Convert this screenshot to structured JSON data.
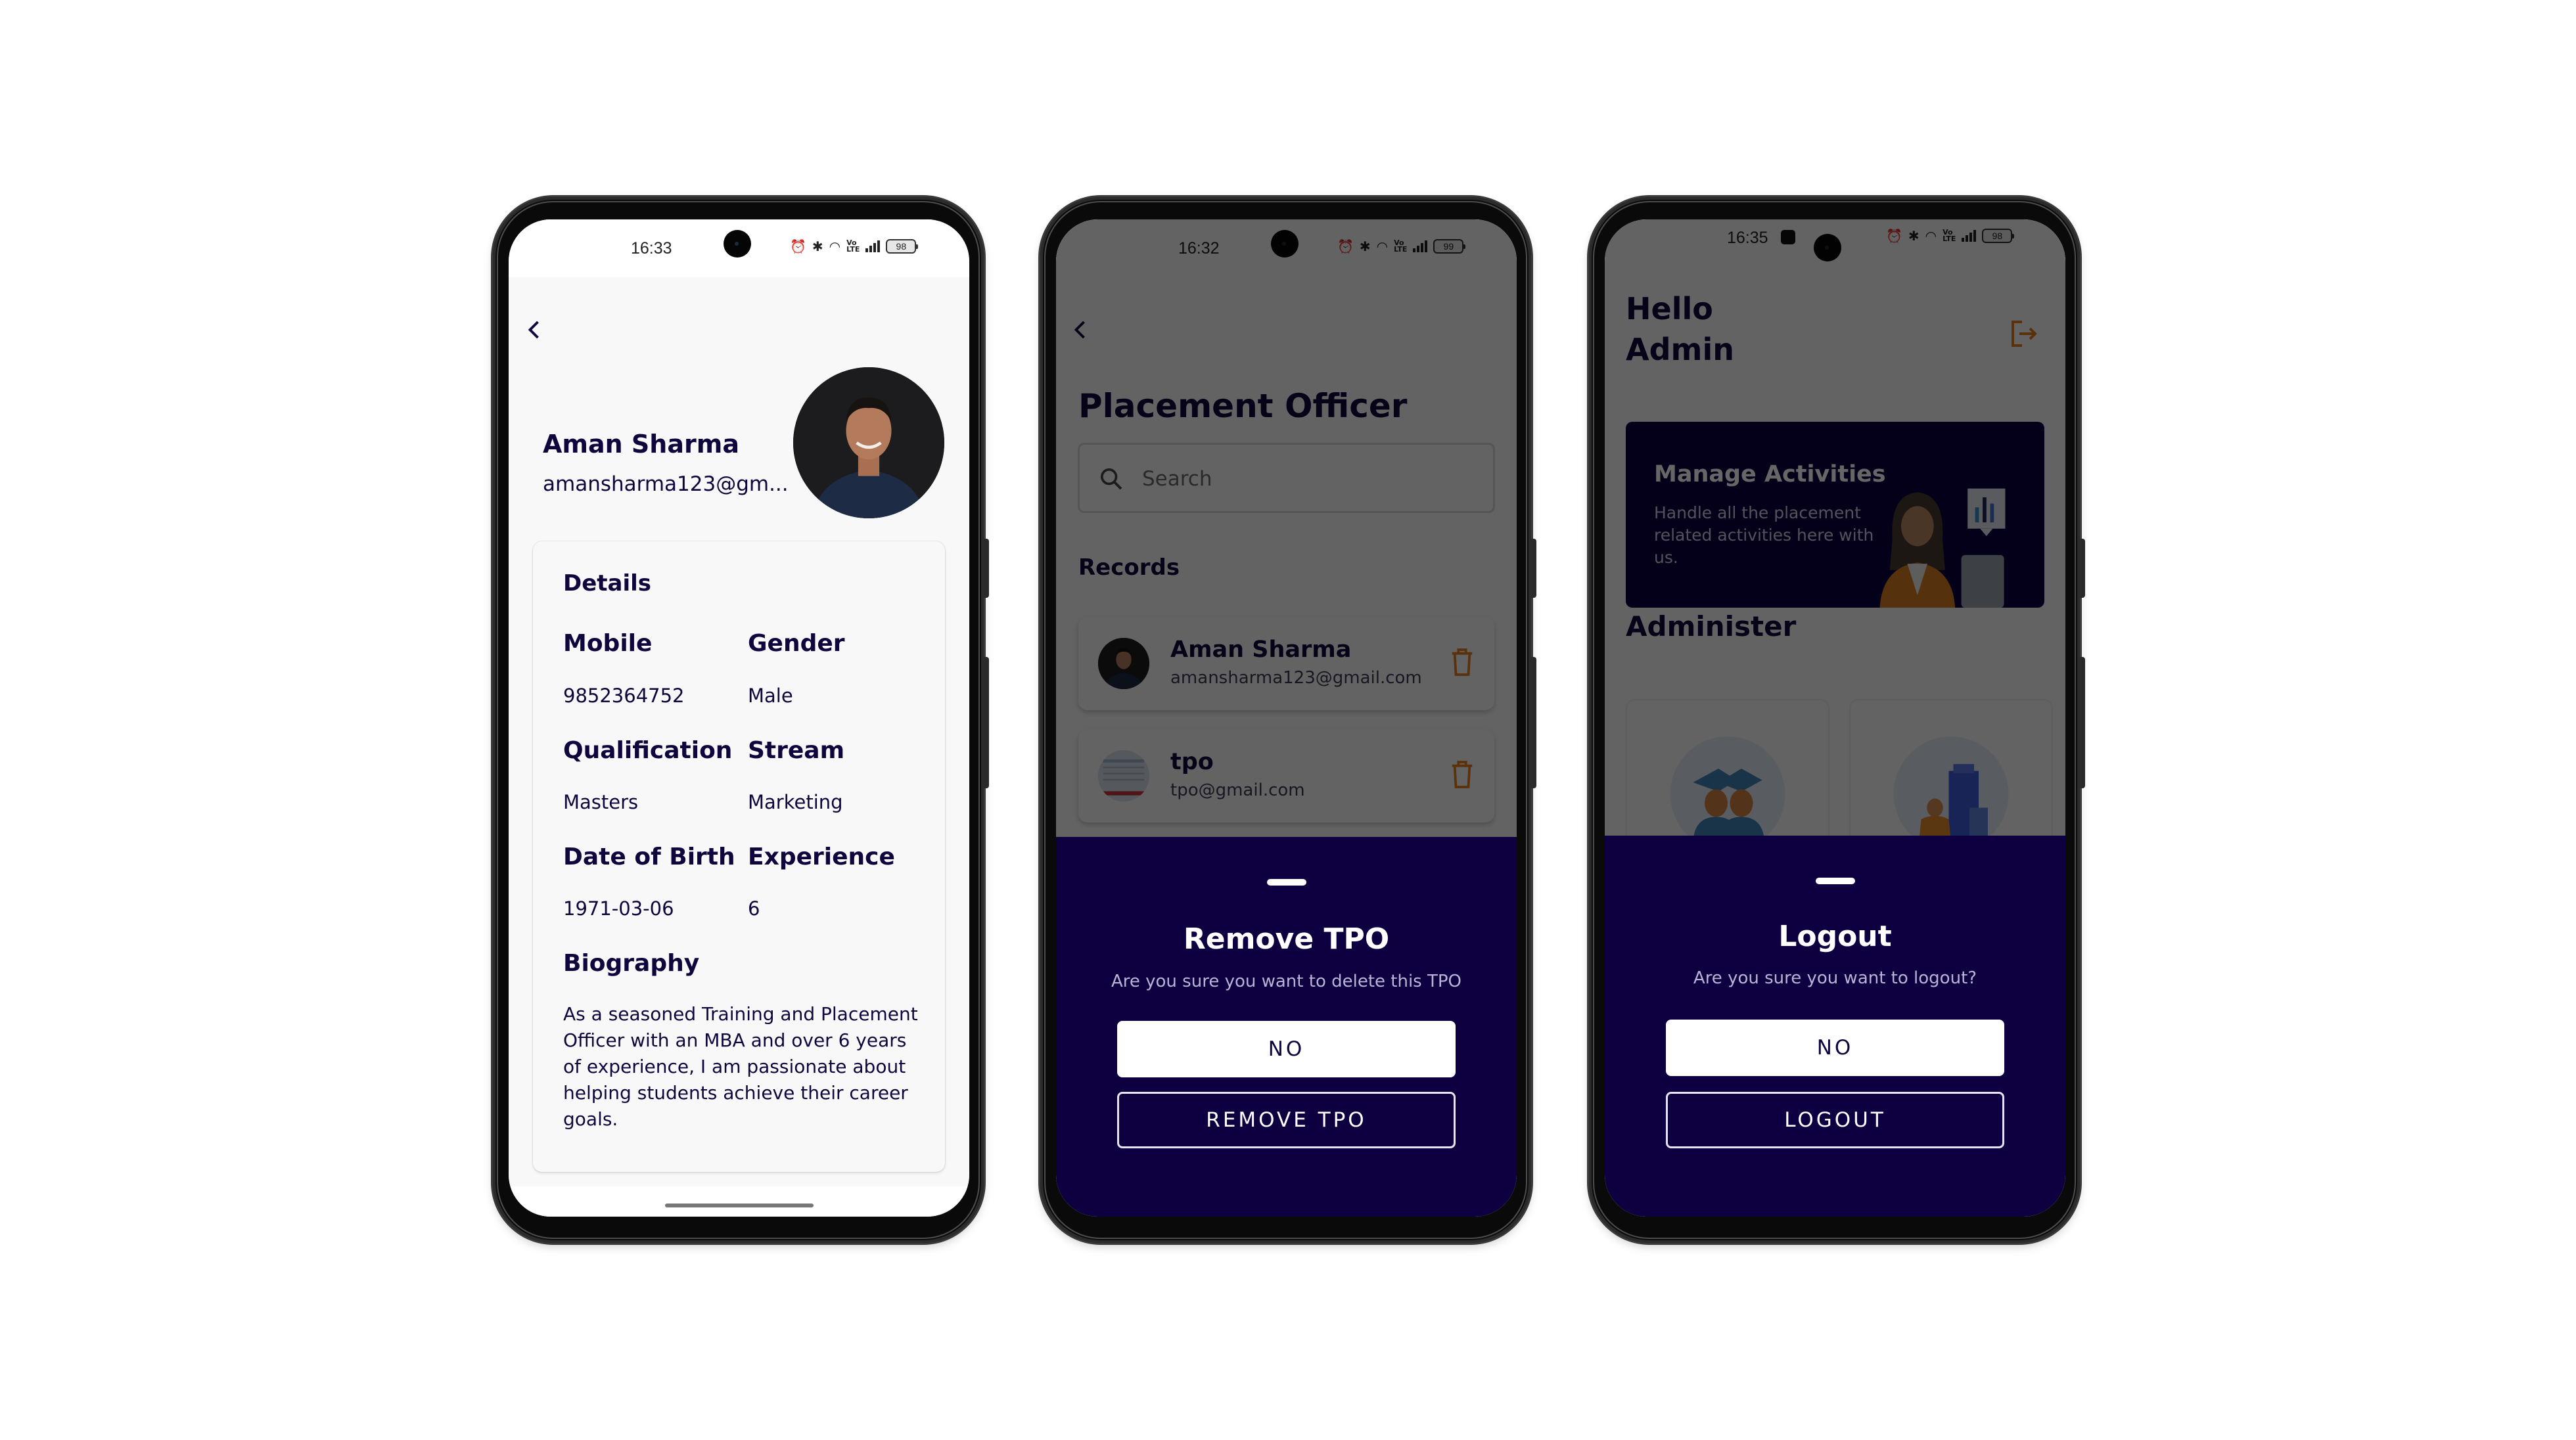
{
  "colors": {
    "primary_navy": "#0e0040",
    "text_navy": "#10063d",
    "accent_orange": "#e07b1a",
    "app_background": "#f8f8f8"
  },
  "phones": [
    {
      "screen": "tpo-profile",
      "status_bar": {
        "time": "16:33",
        "battery": "98",
        "icons": [
          "alarm-icon",
          "bluetooth-icon",
          "wifi-icon",
          "volte-icon",
          "signal-icon",
          "battery-icon"
        ]
      },
      "back_icon": "chevron-left-icon",
      "profile": {
        "name": "Aman Sharma",
        "email": "amansharma123@gm...",
        "avatar": "avatar-photo"
      },
      "details": {
        "heading": "Details",
        "fields": [
          {
            "label": "Mobile",
            "value": "9852364752"
          },
          {
            "label": "Gender",
            "value": "Male"
          },
          {
            "label": "Qualification",
            "value": "Masters"
          },
          {
            "label": "Stream",
            "value": "Marketing"
          },
          {
            "label": "Date of Birth",
            "value": "1971-03-06"
          },
          {
            "label": "Experience",
            "value": "6"
          }
        ],
        "biography_heading": "Biography",
        "biography": "As a seasoned Training and Placement Officer with an MBA and over 6 years of experience, I am passionate about helping students achieve their career goals."
      }
    },
    {
      "screen": "placement-officer-list",
      "status_bar": {
        "time": "16:32",
        "battery": "99",
        "icons": [
          "alarm-icon",
          "bluetooth-icon",
          "wifi-icon",
          "volte-icon",
          "signal-icon",
          "battery-icon"
        ]
      },
      "back_icon": "chevron-left-icon",
      "title": "Placement Officer",
      "search": {
        "placeholder": "Search",
        "value": ""
      },
      "records_label": "Records",
      "records": [
        {
          "name": "Aman Sharma",
          "email": "amansharma123@gmail.com"
        },
        {
          "name": "tpo",
          "email": "tpo@gmail.com"
        }
      ],
      "sheet": {
        "title": "Remove TPO",
        "description": "Are you sure you want to delete this TPO",
        "primary_button": "NO",
        "secondary_button": "REMOVE TPO"
      }
    },
    {
      "screen": "admin-home",
      "status_bar": {
        "time": "16:35",
        "battery": "98",
        "icons": [
          "notification-icon",
          "alarm-icon",
          "bluetooth-icon",
          "wifi-icon",
          "volte-icon",
          "signal-icon",
          "battery-icon"
        ]
      },
      "greeting_line1": "Hello",
      "greeting_line2": "Admin",
      "logout_icon": "logout-icon",
      "banner": {
        "title": "Manage Activities",
        "description": "Handle all the placement related activities here with us."
      },
      "administer_label": "Administer",
      "tiles": [
        {
          "icon": "graduates-icon"
        },
        {
          "icon": "company-building-icon"
        }
      ],
      "sheet": {
        "title": "Logout",
        "description": "Are you sure you want to logout?",
        "primary_button": "NO",
        "secondary_button": "LOGOUT"
      }
    }
  ]
}
